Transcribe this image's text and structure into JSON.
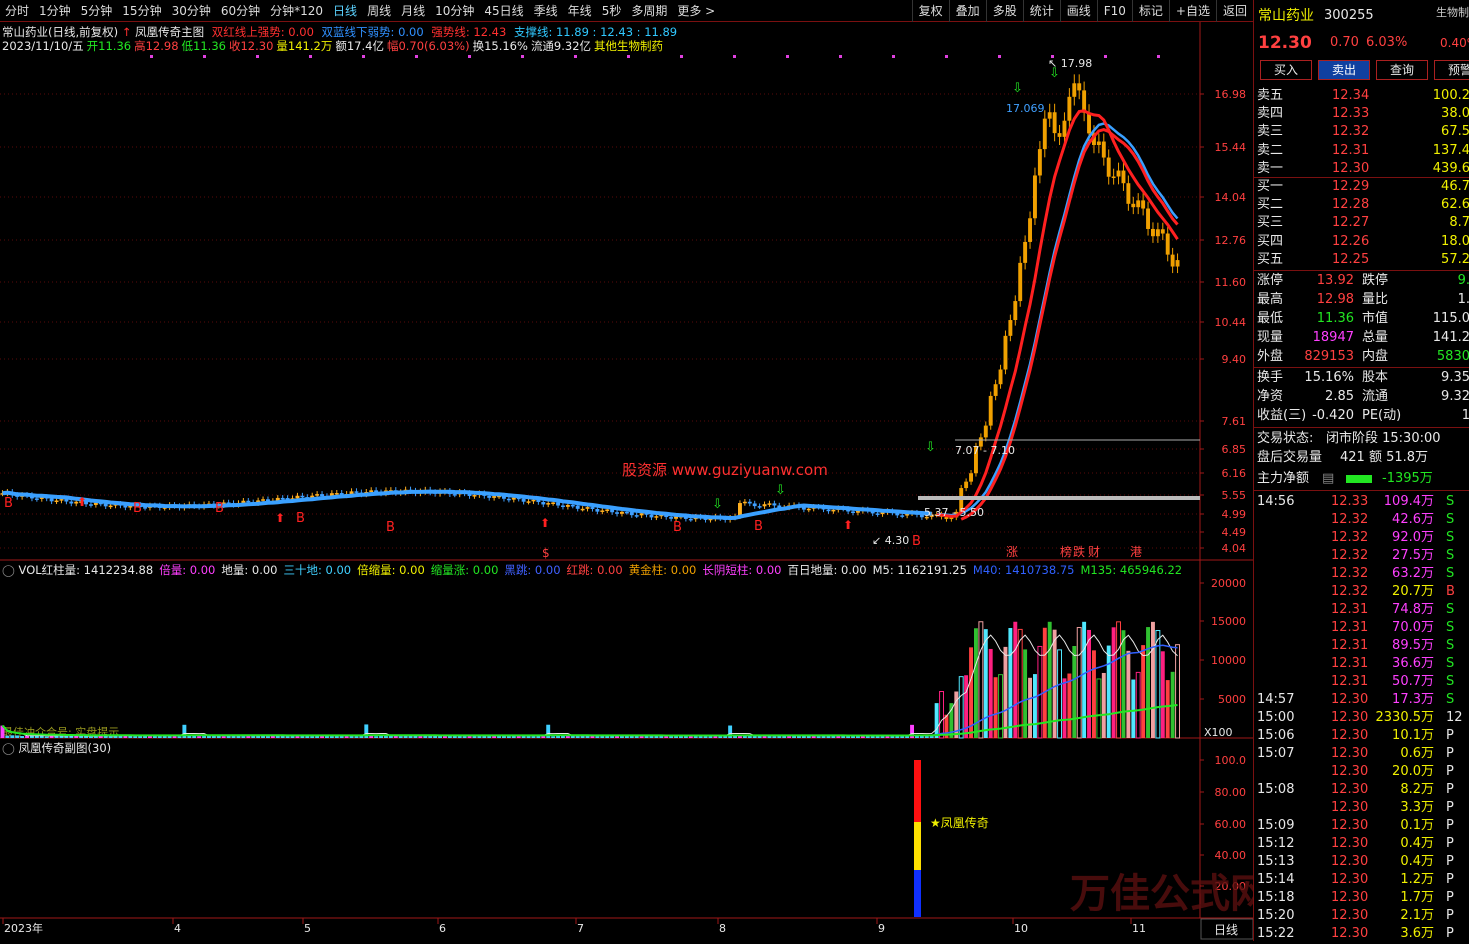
{
  "toolbar": {
    "periods": [
      "分时",
      "1分钟",
      "5分钟",
      "15分钟",
      "30分钟",
      "60分钟",
      "分钟*120",
      "日线",
      "周线",
      "月线",
      "10分钟",
      "45日线",
      "季线",
      "年线",
      "5秒",
      "多周期",
      "更多 >"
    ],
    "active_period": "日线",
    "tools": [
      "复权",
      "叠加",
      "多股",
      "统计",
      "画线",
      "F10",
      "标记",
      "+自选",
      "返回"
    ]
  },
  "main_panel": {
    "title": "常山药业(日线,前复权)",
    "indicator": "凤凰传奇主图",
    "legend": [
      {
        "text": "双红线上强势: 0.00",
        "color": "#ff3030"
      },
      {
        "text": "双蓝线下弱势: 0.00",
        "color": "#3090ff"
      },
      {
        "text": "强势线: 12.43",
        "color": "#ff3030"
      },
      {
        "text": "支撑线: 11.89 : 12.43 : 11.89",
        "color": "#30c8ff"
      }
    ],
    "ohlc_line": [
      {
        "text": "2023/11/10/五",
        "color": "#e8e8e8"
      },
      {
        "text": "开11.36",
        "color": "#22e622"
      },
      {
        "text": "高12.98",
        "color": "#ff4040"
      },
      {
        "text": "低11.36",
        "color": "#22e622"
      },
      {
        "text": "收12.30",
        "color": "#ff4040"
      },
      {
        "text": "量141.2万",
        "color": "#f0f000"
      },
      {
        "text": "额17.4亿",
        "color": "#e8e8e8"
      },
      {
        "text": "幅0.70(6.03%)",
        "color": "#ff4040"
      },
      {
        "text": "换15.16%",
        "color": "#e8e8e8"
      },
      {
        "text": "流通9.32亿",
        "color": "#e8e8e8"
      },
      {
        "text": "其他生物制药",
        "color": "#f0f000"
      }
    ],
    "price_axis": [
      "16.98",
      "15.44",
      "14.04",
      "12.76",
      "11.60",
      "10.44",
      "9.40",
      "7.61",
      "6.85",
      "6.16",
      "5.55",
      "4.99",
      "4.49",
      "4.04"
    ],
    "annotations": {
      "high": "17.98",
      "high2": "17.069",
      "mid": "7.07 - 7.10",
      "low1": "5.37 - 5.50",
      "low2": "4.30",
      "watermark": "股资源  www.guziyuanw.com",
      "tags": [
        "涨",
        "榜",
        "跌",
        "财",
        "港"
      ]
    }
  },
  "vol_panel": {
    "legend": [
      {
        "text": "VOL红柱量: 1412234.88",
        "color": "#e8e8e8"
      },
      {
        "text": "倍量: 0.00",
        "color": "#ff40ff"
      },
      {
        "text": "地量: 0.00",
        "color": "#e8e8e8"
      },
      {
        "text": "三十地: 0.00",
        "color": "#40d0ff"
      },
      {
        "text": "倍缩量: 0.00",
        "color": "#f0f000"
      },
      {
        "text": "缩量涨: 0.00",
        "color": "#22e622"
      },
      {
        "text": "黑跳: 0.00",
        "color": "#4060ff"
      },
      {
        "text": "红跳: 0.00",
        "color": "#ff4040"
      },
      {
        "text": "黄金柱: 0.00",
        "color": "#f0a000"
      },
      {
        "text": "长阴短柱: 0.00",
        "color": "#ff40ff"
      },
      {
        "text": "百日地量: 0.00",
        "color": "#e8e8e8"
      },
      {
        "text": "M5: 1162191.25",
        "color": "#e8e8e8"
      },
      {
        "text": "M40: 1410738.75",
        "color": "#3060ff"
      },
      {
        "text": "M135: 465946.22",
        "color": "#22e622"
      }
    ],
    "axis": [
      "20000",
      "15000",
      "10000",
      "5000"
    ],
    "unit": "X100",
    "sub_text": "最佳冲介合号: 实盘提示"
  },
  "sub_panel": {
    "title": "凤凰传奇副图(30)",
    "axis": [
      "100.0",
      "80.00",
      "60.00",
      "40.00",
      "20.00"
    ],
    "signal_label": "★凤凰传奇"
  },
  "date_axis": [
    "2023年",
    "4",
    "5",
    "6",
    "7",
    "8",
    "9",
    "10",
    "11"
  ],
  "bottom_tab": "日线",
  "quote": {
    "name": "常山药业",
    "code": "300255",
    "sector": "生物制",
    "sector_pct": "0.40%",
    "price": "12.30",
    "change": "0.70",
    "pct": "6.03%",
    "buttons": [
      "买入",
      "卖出",
      "查询",
      "预警"
    ],
    "asks": [
      {
        "label": "卖五",
        "price": "12.34",
        "vol": "100.2"
      },
      {
        "label": "卖四",
        "price": "12.33",
        "vol": "38.0"
      },
      {
        "label": "卖三",
        "price": "12.32",
        "vol": "67.5"
      },
      {
        "label": "卖二",
        "price": "12.31",
        "vol": "137.4"
      },
      {
        "label": "卖一",
        "price": "12.30",
        "vol": "439.6"
      }
    ],
    "bids": [
      {
        "label": "买一",
        "price": "12.29",
        "vol": "46.7"
      },
      {
        "label": "买二",
        "price": "12.28",
        "vol": "62.6"
      },
      {
        "label": "买三",
        "price": "12.27",
        "vol": "8.7"
      },
      {
        "label": "买四",
        "price": "12.26",
        "vol": "18.0"
      },
      {
        "label": "买五",
        "price": "12.25",
        "vol": "57.2"
      }
    ],
    "stats": [
      {
        "l1": "涨停",
        "v1": "13.92",
        "c1": "#ff4040",
        "l2": "跌停",
        "v2": "9.",
        "c2": "#22e622"
      },
      {
        "l1": "最高",
        "v1": "12.98",
        "c1": "#ff4040",
        "l2": "量比",
        "v2": "1.",
        "c2": "#e8e8e8"
      },
      {
        "l1": "最低",
        "v1": "11.36",
        "c1": "#22e622",
        "l2": "市值",
        "v2": "115.0",
        "c2": "#e8e8e8"
      },
      {
        "l1": "现量",
        "v1": "18947",
        "c1": "#ff40ff",
        "l2": "总量",
        "v2": "141.2",
        "c2": "#e8e8e8"
      },
      {
        "l1": "外盘",
        "v1": "829153",
        "c1": "#ff4040",
        "l2": "内盘",
        "v2": "5830",
        "c2": "#22e622"
      }
    ],
    "stats2": [
      {
        "l1": "换手",
        "v1": "15.16%",
        "l2": "股本",
        "v2": "9.35"
      },
      {
        "l1": "净资",
        "v1": "2.85",
        "l2": "流通",
        "v2": "9.32"
      },
      {
        "l1": "收益(三)",
        "v1": "-0.420",
        "l2": "PE(动)",
        "v2": "1"
      }
    ],
    "status_label": "交易状态:",
    "status_value": "闭市阶段 15:30:00",
    "after_label": "盘后交易量",
    "after_value": "421 额 51.8万",
    "main_flow_label": "主力净额",
    "main_flow_value": "-1395万",
    "ticks": [
      {
        "t": "14:56",
        "p": "12.33",
        "v": "109.4万",
        "d": "S"
      },
      {
        "t": "",
        "p": "12.32",
        "v": "42.6万",
        "d": "S"
      },
      {
        "t": "",
        "p": "12.32",
        "v": "92.0万",
        "d": "S"
      },
      {
        "t": "",
        "p": "12.32",
        "v": "27.5万",
        "d": "S"
      },
      {
        "t": "",
        "p": "12.32",
        "v": "63.2万",
        "d": "S"
      },
      {
        "t": "",
        "p": "12.32",
        "v": "20.7万",
        "d": "B"
      },
      {
        "t": "",
        "p": "12.31",
        "v": "74.8万",
        "d": "S"
      },
      {
        "t": "",
        "p": "12.31",
        "v": "70.0万",
        "d": "S"
      },
      {
        "t": "",
        "p": "12.31",
        "v": "89.5万",
        "d": "S"
      },
      {
        "t": "",
        "p": "12.31",
        "v": "36.6万",
        "d": "S"
      },
      {
        "t": "",
        "p": "12.31",
        "v": "50.7万",
        "d": "S"
      },
      {
        "t": "14:57",
        "p": "12.30",
        "v": "17.3万",
        "d": "S"
      },
      {
        "t": "15:00",
        "p": "12.30",
        "v": "2330.5万",
        "d": "12"
      },
      {
        "t": "15:06",
        "p": "12.30",
        "v": "10.1万",
        "d": "P"
      },
      {
        "t": "15:07",
        "p": "12.30",
        "v": "0.6万",
        "d": "P"
      },
      {
        "t": "",
        "p": "12.30",
        "v": "20.0万",
        "d": "P"
      },
      {
        "t": "15:08",
        "p": "12.30",
        "v": "8.2万",
        "d": "P"
      },
      {
        "t": "",
        "p": "12.30",
        "v": "3.3万",
        "d": "P"
      },
      {
        "t": "15:09",
        "p": "12.30",
        "v": "0.1万",
        "d": "P"
      },
      {
        "t": "15:12",
        "p": "12.30",
        "v": "0.4万",
        "d": "P"
      },
      {
        "t": "15:13",
        "p": "12.30",
        "v": "0.4万",
        "d": "P"
      },
      {
        "t": "15:14",
        "p": "12.30",
        "v": "1.2万",
        "d": "P"
      },
      {
        "t": "15:18",
        "p": "12.30",
        "v": "1.7万",
        "d": "P"
      },
      {
        "t": "15:20",
        "p": "12.30",
        "v": "2.1万",
        "d": "P"
      },
      {
        "t": "15:22",
        "p": "12.30",
        "v": "3.6万",
        "d": "P"
      }
    ]
  },
  "watermark2": "万佳公式网"
}
